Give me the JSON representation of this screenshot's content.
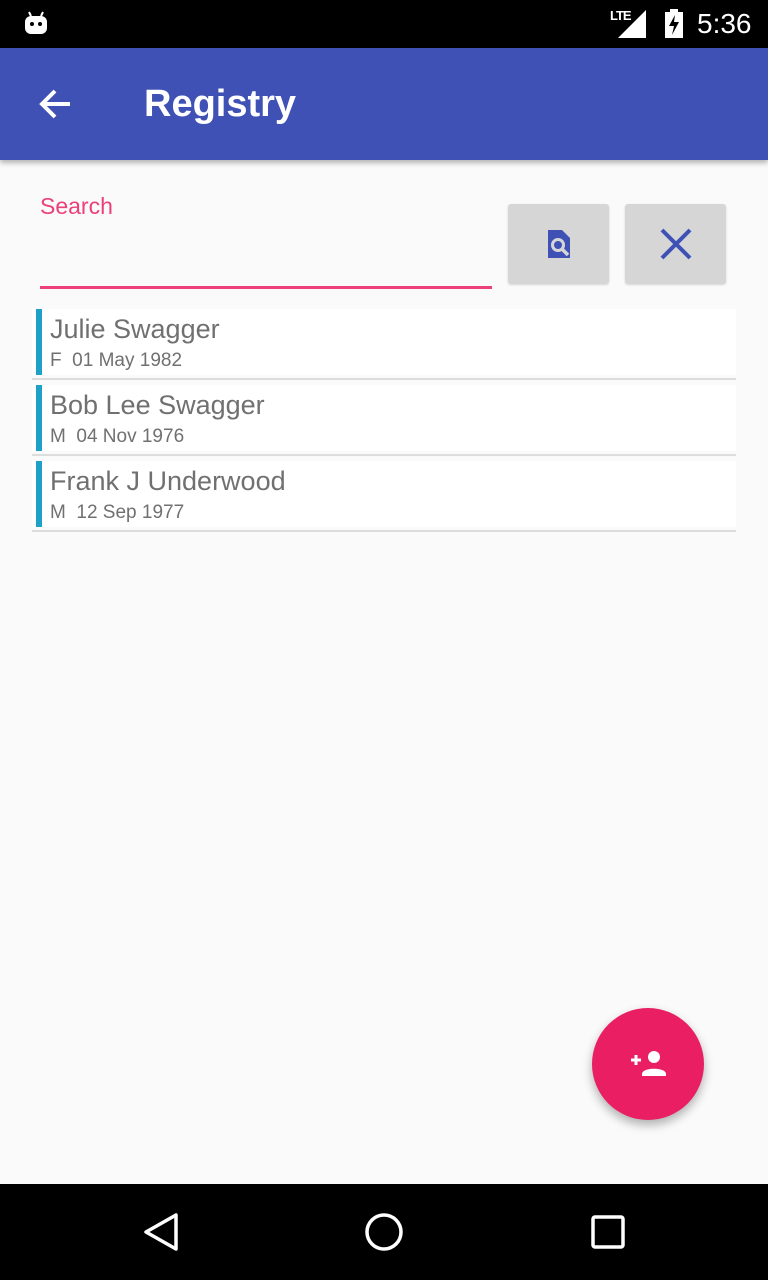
{
  "status_bar": {
    "network": "LTE",
    "time": "5:36"
  },
  "app_bar": {
    "title": "Registry",
    "back_icon": "arrow-back-icon"
  },
  "search": {
    "label": "Search",
    "value": "",
    "search_icon": "find-in-page-icon",
    "clear_icon": "close-icon"
  },
  "people": [
    {
      "name": "Julie  Swagger",
      "meta": "F  01 May 1982"
    },
    {
      "name": "Bob Lee Swagger",
      "meta": "M  04 Nov 1976"
    },
    {
      "name": "Frank J Underwood",
      "meta": "M  12 Sep 1977"
    }
  ],
  "fab": {
    "icon": "person-add-icon"
  },
  "nav_bar": {
    "icons": [
      "back-triangle-icon",
      "home-circle-icon",
      "recents-square-icon"
    ]
  },
  "colors": {
    "primary": "#3f51b5",
    "accent": "#ec407a",
    "fab": "#e91e63",
    "row_accent": "#1fa0c9"
  }
}
